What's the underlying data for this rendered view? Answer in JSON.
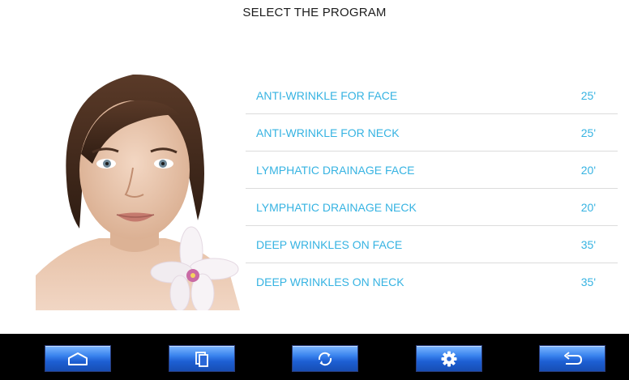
{
  "header": {
    "title": "SELECT THE PROGRAM"
  },
  "programs": [
    {
      "name": "ANTI-WRINKLE FOR FACE",
      "duration": "25'"
    },
    {
      "name": "ANTI-WRINKLE FOR NECK",
      "duration": "25'"
    },
    {
      "name": "LYMPHATIC DRAINAGE FACE",
      "duration": "20'"
    },
    {
      "name": "LYMPHATIC DRAINAGE NECK",
      "duration": "20'"
    },
    {
      "name": "DEEP WRINKLES ON FACE",
      "duration": "35'"
    },
    {
      "name": "DEEP WRINKLES ON NECK",
      "duration": "35'"
    }
  ],
  "nav": {
    "buttons": [
      {
        "icon": "home-icon"
      },
      {
        "icon": "copy-icon"
      },
      {
        "icon": "refresh-icon"
      },
      {
        "icon": "gear-icon"
      },
      {
        "icon": "back-icon"
      }
    ]
  },
  "colors": {
    "accent": "#36b3e2",
    "nav_bar": "#000000",
    "nav_button": "#2f73e0",
    "divider": "#dcdcdc"
  }
}
